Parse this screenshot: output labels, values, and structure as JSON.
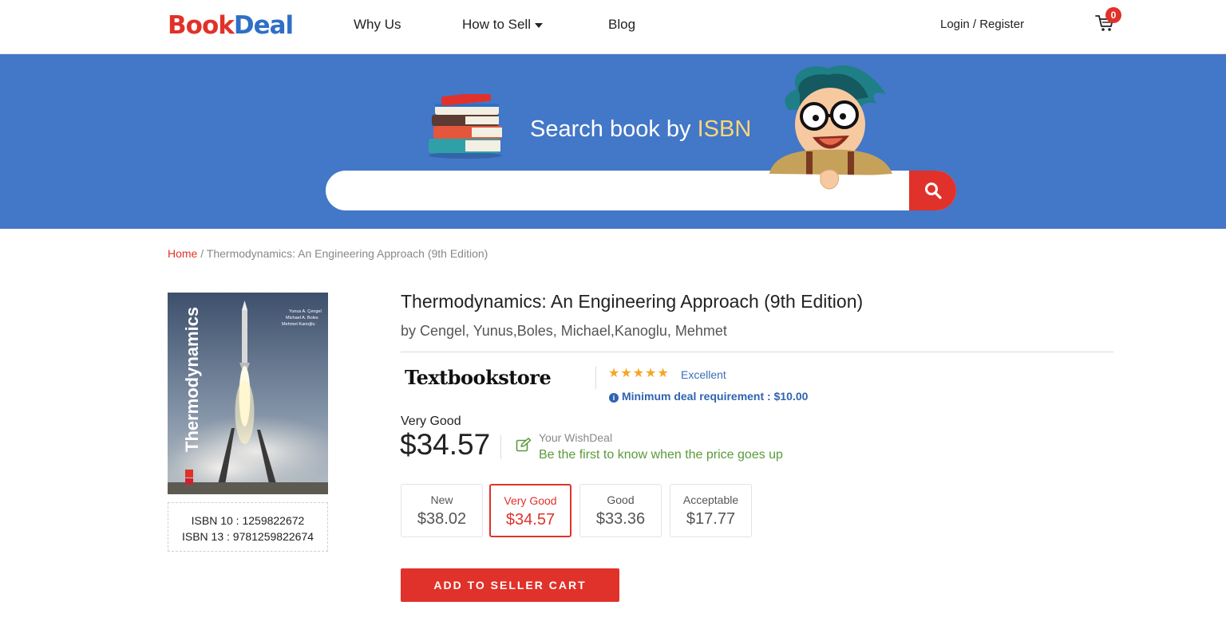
{
  "header": {
    "logo_part1": "B",
    "logo_part2": "ook",
    "logo_part3": "Deal",
    "nav": [
      {
        "label": "Why Us"
      },
      {
        "label": "How to Sell"
      },
      {
        "label": "Blog"
      }
    ],
    "login_label": "Login / Register",
    "cart_count": "0"
  },
  "hero": {
    "title_prefix": "Search book by ",
    "title_highlight": "ISBN",
    "search_placeholder": ""
  },
  "breadcrumb": {
    "home": "Home",
    "separator": " / ",
    "current": "Thermodynamics: An Engineering Approach (9th Edition)"
  },
  "book": {
    "title": "Thermodynamics: An Engineering Approach (9th Edition)",
    "authors": "by Cengel, Yunus,Boles, Michael,Kanoglu, Mehmet",
    "cover_title": "Thermodynamics",
    "cover_authors": [
      "Yunus A. Çengel",
      "Michael A. Boles",
      "Mehmet Kanoğlu"
    ],
    "isbn10": "ISBN 10 : 1259822672",
    "isbn13": "ISBN 13 : 9781259822674"
  },
  "store": {
    "name": "Textbookstore",
    "stars": "★★★★★",
    "rating_text": "Excellent",
    "min_deal": "Minimum deal requirement : $10.00"
  },
  "offer": {
    "selected_condition": "Very Good",
    "price": "$34.57",
    "wish_title": "Your WishDeal",
    "wish_sub": "Be the first to know when the price goes up"
  },
  "conditions": [
    {
      "label": "New",
      "price": "$38.02"
    },
    {
      "label": "Very Good",
      "price": "$34.57"
    },
    {
      "label": "Good",
      "price": "$33.36"
    },
    {
      "label": "Acceptable",
      "price": "$17.77"
    }
  ],
  "add_cart_label": "ADD TO SELLER CART",
  "colors": {
    "brand_red": "#e0322a",
    "brand_blue": "#4377c7",
    "accent_yellow": "#f8d77a",
    "green": "#5a9a3c"
  }
}
